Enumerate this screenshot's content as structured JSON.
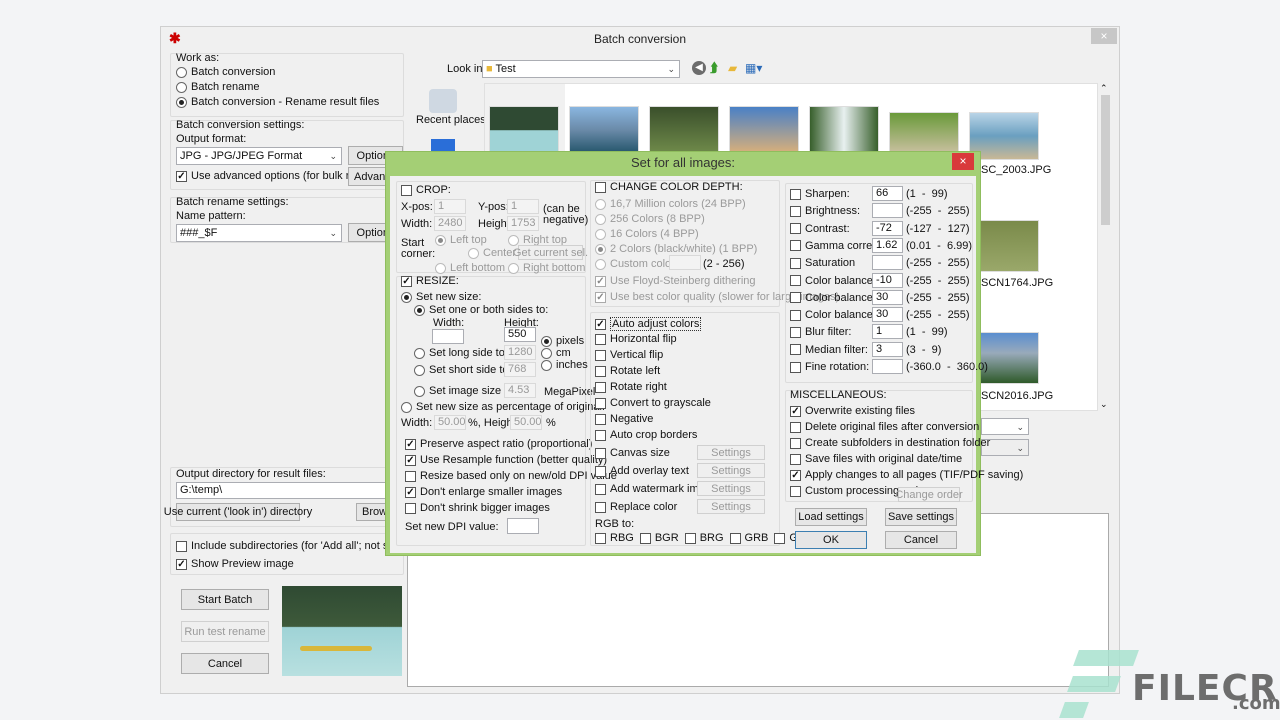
{
  "window": {
    "title": "Batch conversion",
    "app_icon": "splat-icon",
    "close_label": "×"
  },
  "work_as": {
    "label": "Work as:",
    "options": [
      "Batch conversion",
      "Batch rename",
      "Batch conversion - Rename result files"
    ],
    "selected": 2
  },
  "conversion_settings": {
    "label": "Batch conversion settings:",
    "output_format_label": "Output format:",
    "output_format_value": "JPG - JPG/JPEG Format",
    "options_button": "Options",
    "use_advanced_label": "Use advanced options (for bulk resize...)",
    "use_advanced_checked": true,
    "advanced_button": "Advanced"
  },
  "rename_settings": {
    "label": "Batch rename settings:",
    "name_pattern_label": "Name pattern:",
    "name_pattern_value": "###_$F",
    "options_button": "Options"
  },
  "output_dir": {
    "label": "Output directory for result files:",
    "value": "G:\\temp\\",
    "use_current_button": "Use current ('look in') directory",
    "browse_button": "Browse"
  },
  "include_subdirs": {
    "label": "Include subdirectories (for 'Add all'; not saved on exit)",
    "checked": false
  },
  "show_preview": {
    "label": "Show Preview image",
    "checked": true
  },
  "actions": {
    "start_batch": "Start Batch",
    "run_test_rename": "Run test rename",
    "cancel": "Cancel"
  },
  "browser": {
    "look_in_label": "Look in:",
    "look_in_value": "Test",
    "toolbar_icons": [
      "back-icon",
      "up-folder-icon",
      "new-folder-icon",
      "view-menu-icon"
    ],
    "places": [
      {
        "label": "Recent places",
        "icon": "recent-places-icon"
      },
      {
        "label": "",
        "icon": "desktop-icon"
      }
    ],
    "files": [
      "",
      "",
      "",
      "",
      "",
      "",
      "SC_2003.JPG",
      "SCN1764.JPG",
      "SCN2016.JPG"
    ]
  },
  "dialog": {
    "title": "Set for all images:",
    "close_label": "×",
    "crop": {
      "label": "CROP:",
      "checked": false,
      "xpos_label": "X-pos:",
      "xpos": "1",
      "ypos_label": "Y-pos:",
      "ypos": "1",
      "can_be_negative": "(can be negative)",
      "width_label": "Width:",
      "width": "2480",
      "height_label": "Height:",
      "height": "1753",
      "start_corner_label": "Start corner:",
      "corners": [
        "Left top",
        "Right top",
        "Center",
        "Left bottom",
        "Right bottom"
      ],
      "selected_corner": 0,
      "get_current_sel": "Get current sel."
    },
    "resize": {
      "label": "RESIZE:",
      "checked": true,
      "set_new_size": "Set new size:",
      "set_one_or_both": "Set one or both sides to:",
      "width_label": "Width:",
      "height_label": "Height:",
      "width": "",
      "height": "550",
      "units": [
        "pixels",
        "cm",
        "inches"
      ],
      "selected_unit": 0,
      "set_long_side": "Set long side to:",
      "long_side": "1280",
      "set_short_side": "Set short side to:",
      "short_side": "768",
      "set_image_size": "Set image size to:",
      "image_size": "4.53",
      "megapixel": "MegaPixel",
      "set_percentage": "Set new size as percentage of original:",
      "pct_width_label": "Width:",
      "pct_width": "50.00",
      "pct_height_label": "%, Height:",
      "pct_height": "50.00",
      "pct_suffix": "%",
      "preserve_aspect": {
        "label": "Preserve aspect ratio (proportional)",
        "checked": true
      },
      "use_resample": {
        "label": "Use Resample function (better quality)",
        "checked": true
      },
      "resize_dpi": {
        "label": "Resize based only on new/old DPI value",
        "checked": false
      },
      "dont_enlarge": {
        "label": "Don't enlarge smaller images",
        "checked": true
      },
      "dont_shrink": {
        "label": "Don't shrink bigger images",
        "checked": false
      },
      "dpi_label": "Set new DPI value:",
      "dpi_value": ""
    },
    "color_depth": {
      "label": "CHANGE COLOR DEPTH:",
      "checked": false,
      "options": [
        "16,7 Million colors (24 BPP)",
        "256 Colors (8 BPP)",
        "16 Colors (4 BPP)",
        "2 Colors (black/white) (1 BPP)",
        "Custom colors:"
      ],
      "selected": 3,
      "custom_range": "(2 - 256)",
      "floyd": {
        "label": "Use Floyd-Steinberg dithering",
        "checked": true
      },
      "best_quality": {
        "label": "Use best color quality (slower for large images)",
        "checked": true
      }
    },
    "transforms": [
      {
        "label": "Auto adjust colors",
        "checked": true
      },
      {
        "label": "Horizontal flip",
        "checked": false
      },
      {
        "label": "Vertical flip",
        "checked": false
      },
      {
        "label": "Rotate left",
        "checked": false
      },
      {
        "label": "Rotate right",
        "checked": false
      },
      {
        "label": "Convert to grayscale",
        "checked": false
      },
      {
        "label": "Negative",
        "checked": false
      },
      {
        "label": "Auto crop borders",
        "checked": false
      }
    ],
    "with_settings": [
      {
        "label": "Canvas size",
        "checked": false,
        "button": "Settings"
      },
      {
        "label": "Add overlay text",
        "checked": false,
        "button": "Settings"
      },
      {
        "label": "Add watermark image",
        "checked": false,
        "button": "Settings"
      },
      {
        "label": "Replace color",
        "checked": false,
        "button": "Settings"
      }
    ],
    "rgb_to": {
      "label": "RGB to:",
      "options": [
        "RBG",
        "BGR",
        "BRG",
        "GRB",
        "GBR"
      ]
    },
    "adjustments": [
      {
        "label": "Sharpen:",
        "value": "66",
        "range": "(1  -  99)"
      },
      {
        "label": "Brightness:",
        "value": "",
        "range": "(-255  -  255)"
      },
      {
        "label": "Contrast:",
        "value": "-72",
        "range": "(-127  -  127)"
      },
      {
        "label": "Gamma correction:",
        "value": "1.62",
        "range": "(0.01  -  6.99)"
      },
      {
        "label": "Saturation",
        "value": "",
        "range": "(-255  -  255)"
      },
      {
        "label": "Color balance - R:",
        "value": "-10",
        "range": "(-255  -  255)"
      },
      {
        "label": "Color balance - G:",
        "value": "30",
        "range": "(-255  -  255)"
      },
      {
        "label": "Color balance - B:",
        "value": "30",
        "range": "(-255  -  255)"
      },
      {
        "label": "Blur filter:",
        "value": "1",
        "range": "(1  -  99)"
      },
      {
        "label": "Median filter:",
        "value": "3",
        "range": "(3  -  9)"
      },
      {
        "label": "Fine rotation:",
        "value": "",
        "range": "(-360.0  -  360.0)"
      }
    ],
    "misc": {
      "label": "MISCELLANEOUS:",
      "items": [
        {
          "label": "Overwrite existing files",
          "checked": true
        },
        {
          "label": "Delete original files after conversion",
          "checked": false
        },
        {
          "label": "Create subfolders in destination folder",
          "checked": false
        },
        {
          "label": "Save files with original date/time",
          "checked": false
        },
        {
          "label": "Apply changes to all pages (TIF/PDF saving)",
          "checked": true
        },
        {
          "label": "Custom processing order",
          "checked": false
        }
      ],
      "change_order": "Change order"
    },
    "load_settings": "Load settings",
    "save_settings": "Save settings",
    "ok": "OK",
    "cancel": "Cancel"
  },
  "watermark": {
    "brand": "FILECR",
    "suffix": ".com"
  }
}
